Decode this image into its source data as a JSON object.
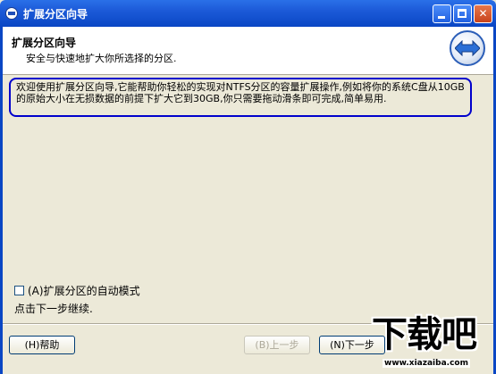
{
  "window": {
    "title": "扩展分区向导",
    "icon": "app-icon",
    "controls": [
      "minimize-icon",
      "maximize-icon",
      "close-icon"
    ]
  },
  "header": {
    "title": "扩展分区向导",
    "subtitle": "安全与快速地扩大你所选择的分区.",
    "icon": "resize-arrows-icon"
  },
  "description": "欢迎使用扩展分区向导,它能帮助你轻松的实现对NTFS分区的容量扩展操作,例如将你的系统C盘从10GB的原始大小在无损数据的前提下扩大它到30GB,你只需要拖动滑条即可完成,简单易用.",
  "options": {
    "auto_mode_label": "(A)扩展分区的自动模式",
    "auto_mode_checked": false
  },
  "hint": "点击下一步继续.",
  "buttons": {
    "help": "(H)帮助",
    "back": "(B)上一步",
    "next": "(N)下一步"
  },
  "watermark": {
    "text": "下载吧",
    "url": "www.xiazaiba.com"
  },
  "colors": {
    "titlebar": "#0a46c4",
    "highlight_border": "#0000cc",
    "dialog_bg": "#ece9d8"
  }
}
